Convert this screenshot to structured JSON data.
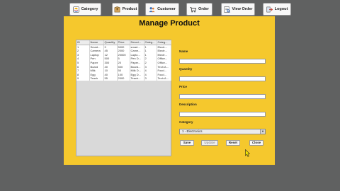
{
  "nav": {
    "category": "Category",
    "product": "Product",
    "customer": "Customer",
    "order": "Order",
    "view_order": "View Order",
    "logout": "Logout"
  },
  "form": {
    "title": "Manage Product",
    "name_label": "Name",
    "quantity_label": "Quantity",
    "price_label": "Price",
    "description_label": "Description",
    "category_label": "Category",
    "name_value": "",
    "quantity_value": "",
    "price_value": "",
    "description_value": "",
    "category_selected": "1 - Electronics"
  },
  "buttons": {
    "save": "Save",
    "update": "Update",
    "reset": "Reset",
    "close": "Close"
  },
  "table": {
    "headers": [
      "ID",
      "Name",
      "Quantity",
      "Price",
      "Descri...",
      "Categ...",
      "Categ..."
    ],
    "rows": [
      [
        "1",
        "Smart...",
        "9",
        "5000",
        "smart...",
        "1",
        "Electr..."
      ],
      [
        "2",
        "Camera",
        "45",
        "2000",
        "Came...",
        "1",
        "Electr..."
      ],
      [
        "3",
        "Laptop",
        "12",
        "20000",
        "Lapto...",
        "1",
        "Electr..."
      ],
      [
        "4",
        "Pen",
        "500",
        "5",
        "Pen D...",
        "2",
        "Office..."
      ],
      [
        "5",
        "Paper",
        "300",
        "20",
        "Paper...",
        "2",
        "Office..."
      ],
      [
        "6",
        "Board",
        "40",
        "500",
        "Board...",
        "3",
        "Tech A..."
      ],
      [
        "7",
        "Milk",
        "10",
        "50",
        "Milk D...",
        "4",
        "Food..."
      ],
      [
        "8",
        "Egg",
        "40",
        "100",
        "Egg D...",
        "4",
        "Food..."
      ],
      [
        "9",
        "Teach",
        "55",
        "2000",
        "Teach...",
        "3",
        "Tech A..."
      ]
    ]
  },
  "icons": {
    "category": "category-icon",
    "product": "product-icon",
    "customer": "customer-icon",
    "order": "order-icon",
    "view_order": "view-order-icon",
    "logout": "logout-icon"
  },
  "colors": {
    "background": "#606161",
    "panel": "#f5c82d"
  }
}
